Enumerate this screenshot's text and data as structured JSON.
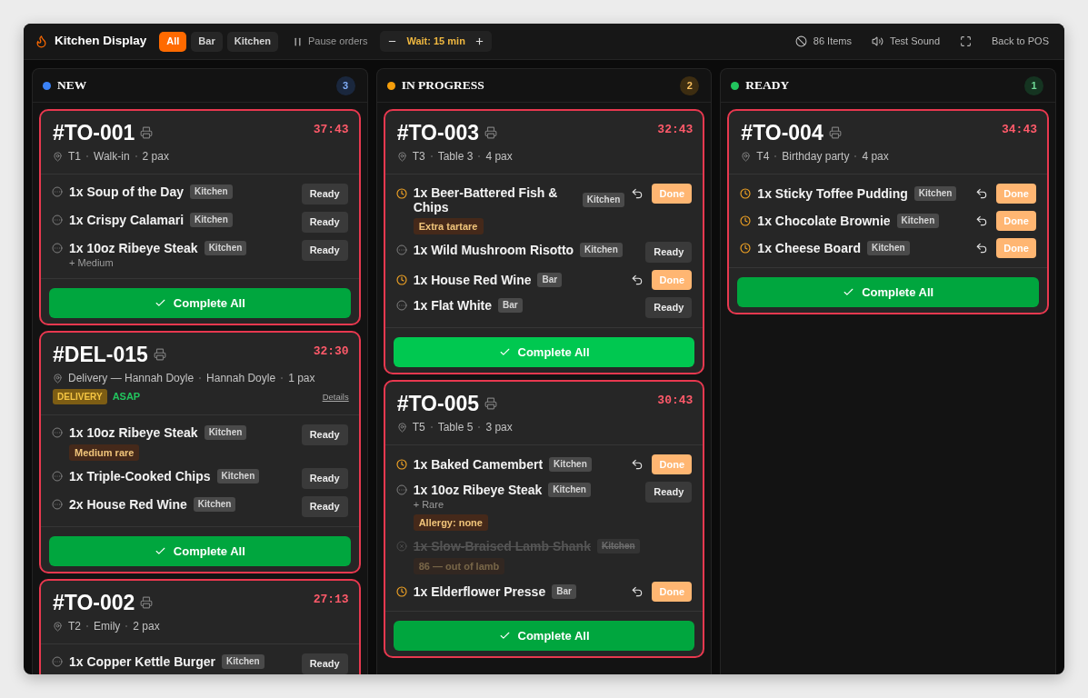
{
  "app": {
    "title": "Kitchen Display"
  },
  "filters": [
    {
      "label": "All",
      "selected": true
    },
    {
      "label": "Bar",
      "selected": false
    },
    {
      "label": "Kitchen",
      "selected": false
    }
  ],
  "pause_button": {
    "label": "Pause orders"
  },
  "wait_control": {
    "label": "Wait: 15 min"
  },
  "toolbar": [
    {
      "kind": "eighty_six",
      "label": "86 Items"
    },
    {
      "kind": "sound",
      "label": "Test Sound"
    },
    {
      "kind": "fullscreen"
    },
    {
      "kind": "back",
      "label": "Back to POS"
    }
  ],
  "columns": [
    {
      "title": "NEW",
      "count": "3",
      "color": "#3b82f6",
      "cards": [
        {
          "number": "#TO-001",
          "timer": "37:43",
          "overdue": true,
          "meta": [
            "T1",
            "Walk-in",
            "2 pax"
          ],
          "items": [
            {
              "kind": "pending",
              "name": "1x Soup of the Day",
              "station": "Kitchen",
              "action": "Ready"
            },
            {
              "kind": "pending",
              "name": "1x Crispy Calamari",
              "station": "Kitchen",
              "action": "Ready"
            },
            {
              "kind": "pending",
              "name": "1x 10oz Ribeye Steak",
              "station": "Kitchen",
              "modifier": "+ Medium",
              "action": "Ready"
            }
          ],
          "complete": {
            "label": "Complete All",
            "highlighted": false
          }
        },
        {
          "number": "#DEL-015",
          "timer": "32:30",
          "overdue": true,
          "meta": [
            "Delivery — Hannah Doyle",
            "Hannah Doyle",
            "1 pax"
          ],
          "tags": {
            "type": "DELIVERY",
            "priority": "ASAP",
            "link": "Details"
          },
          "items": [
            {
              "kind": "pending",
              "name": "1x 10oz Ribeye Steak",
              "station": "Kitchen",
              "note": "Medium rare",
              "action": "Ready"
            },
            {
              "kind": "pending",
              "name": "1x Triple-Cooked Chips",
              "station": "Kitchen",
              "action": "Ready"
            },
            {
              "kind": "pending",
              "name": "2x House Red Wine",
              "station": "Kitchen",
              "action": "Ready"
            }
          ],
          "complete": {
            "label": "Complete All",
            "highlighted": false
          }
        },
        {
          "number": "#TO-002",
          "timer": "27:13",
          "overdue": true,
          "meta": [
            "T2",
            "Emily",
            "2 pax"
          ],
          "items": [
            {
              "kind": "pending",
              "name": "1x Copper Kettle Burger",
              "station": "Kitchen",
              "action": "Ready"
            }
          ]
        }
      ]
    },
    {
      "title": "IN PROGRESS",
      "count": "2",
      "color": "#f59e0b",
      "cards": [
        {
          "number": "#TO-003",
          "timer": "32:43",
          "overdue": true,
          "meta": [
            "T3",
            "Table 3",
            "4 pax"
          ],
          "items": [
            {
              "kind": "cooking",
              "name": "1x Beer-Battered Fish & Chips",
              "station": "Kitchen",
              "note": "Extra tartare",
              "action": "Done"
            },
            {
              "kind": "pending",
              "name": "1x Wild Mushroom Risotto",
              "station": "Kitchen",
              "action": "Ready"
            },
            {
              "kind": "cooking",
              "name": "1x House Red Wine",
              "station": "Bar",
              "action": "Done"
            },
            {
              "kind": "pending",
              "name": "1x Flat White",
              "station": "Bar",
              "action": "Ready"
            }
          ],
          "complete": {
            "label": "Complete All",
            "highlighted": true
          }
        },
        {
          "number": "#TO-005",
          "timer": "30:43",
          "overdue": true,
          "meta": [
            "T5",
            "Table 5",
            "3 pax"
          ],
          "items": [
            {
              "kind": "cooking",
              "name": "1x Baked Camembert",
              "station": "Kitchen",
              "action": "Done"
            },
            {
              "kind": "pending",
              "name": "1x 10oz Ribeye Steak",
              "station": "Kitchen",
              "modifier": "+ Rare",
              "note": "Allergy: none",
              "action": "Ready"
            },
            {
              "kind": "unavailable",
              "name": "1x Slow-Braised Lamb Shank",
              "station": "Kitchen",
              "note": "86 — out of lamb"
            },
            {
              "kind": "cooking",
              "name": "1x Elderflower Presse",
              "station": "Bar",
              "action": "Done"
            }
          ],
          "complete": {
            "label": "Complete All",
            "highlighted": false
          }
        }
      ]
    },
    {
      "title": "READY",
      "count": "1",
      "color": "#22c55e",
      "cards": [
        {
          "number": "#TO-004",
          "timer": "34:43",
          "overdue": true,
          "meta": [
            "T4",
            "Birthday party",
            "4 pax"
          ],
          "items": [
            {
              "kind": "cooking",
              "name": "1x Sticky Toffee Pudding",
              "station": "Kitchen",
              "action": "Done"
            },
            {
              "kind": "cooking",
              "name": "1x Chocolate Brownie",
              "station": "Kitchen",
              "action": "Done"
            },
            {
              "kind": "cooking",
              "name": "1x Cheese Board",
              "station": "Kitchen",
              "action": "Done"
            }
          ],
          "complete": {
            "label": "Complete All",
            "highlighted": false
          }
        }
      ]
    }
  ]
}
